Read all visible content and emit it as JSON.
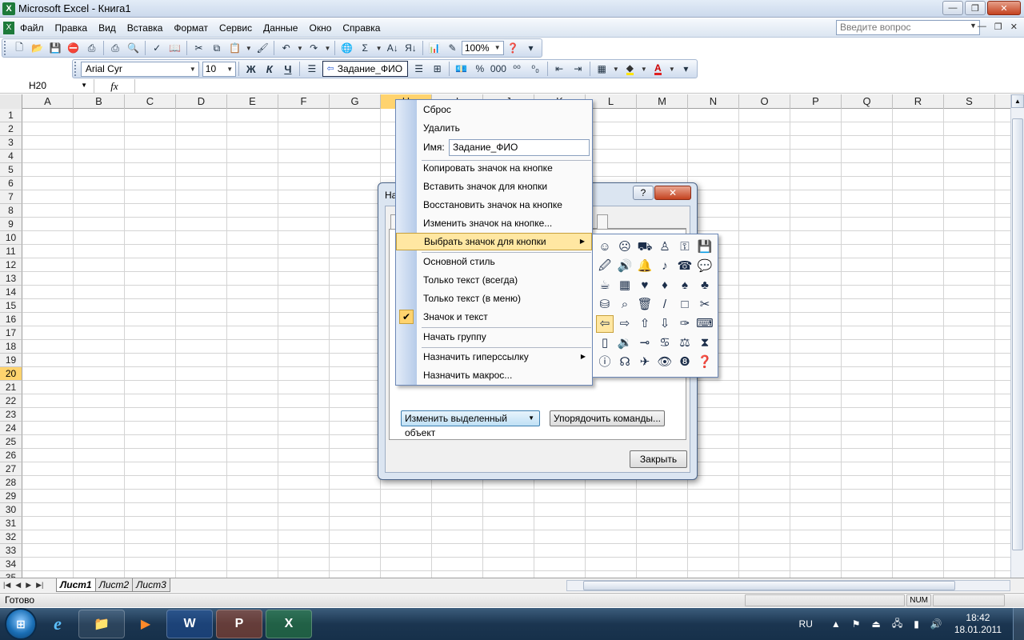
{
  "window": {
    "title": "Microsoft Excel - Книга1",
    "app_icon": "X"
  },
  "menubar": {
    "items": [
      "Файл",
      "Правка",
      "Вид",
      "Вставка",
      "Формат",
      "Сервис",
      "Данные",
      "Окно",
      "Справка"
    ],
    "ask_placeholder": "Введите вопрос"
  },
  "toolbar_standard": {
    "zoom": "100%"
  },
  "toolbar_format": {
    "font": "Arial Cyr",
    "size": "10",
    "custom_button": "Задание_ФИО"
  },
  "formula_bar": {
    "name_box": "H20",
    "fx": "fx"
  },
  "grid": {
    "columns": [
      "A",
      "B",
      "C",
      "D",
      "E",
      "F",
      "G",
      "H",
      "I",
      "J",
      "K",
      "L",
      "M",
      "N",
      "O",
      "P",
      "Q",
      "R",
      "S"
    ],
    "rows": [
      "1",
      "2",
      "3",
      "4",
      "5",
      "6",
      "7",
      "8",
      "9",
      "10",
      "11",
      "12",
      "13",
      "14",
      "15",
      "16",
      "17",
      "18",
      "19",
      "20",
      "21",
      "22",
      "23",
      "24",
      "25",
      "26",
      "27",
      "28",
      "29",
      "30",
      "31",
      "32",
      "33",
      "34",
      "35"
    ],
    "active_row": "20",
    "active_col": "H"
  },
  "sheets": {
    "tabs": [
      "Лист1",
      "Лист2",
      "Лист3"
    ],
    "active": "Лист1"
  },
  "status": {
    "text": "Готово",
    "num": "NUM"
  },
  "dialog": {
    "title_partial": "На",
    "help": "?",
    "close_x": "✕",
    "modify_button": "Изменить выделенный объект",
    "rearrange_button": "Упорядочить команды...",
    "close_button": "Закрыть"
  },
  "context_menu": {
    "reset": "Сброс",
    "delete": "Удалить",
    "name_label": "Имя:",
    "name_value": "Задание_ФИО",
    "copy_icon": "Копировать значок на кнопке",
    "paste_icon": "Вставить значок для кнопки",
    "restore_icon": "Восстановить значок на кнопке",
    "edit_icon": "Изменить значок на кнопке...",
    "choose_icon": "Выбрать значок для кнопки",
    "default_style": "Основной стиль",
    "text_only_always": "Только текст (всегда)",
    "text_only_menu": "Только текст (в меню)",
    "icon_and_text": "Значок и текст",
    "begin_group": "Начать группу",
    "assign_hyperlink": "Назначить гиперссылку",
    "assign_macro": "Назначить макрос..."
  },
  "icon_palette": {
    "icons": [
      "☺",
      "☹",
      "⛟",
      "♙",
      "⚿",
      "💾",
      "🖉",
      "🔊",
      "🔔",
      "♪",
      "☎",
      "💬",
      "☕",
      "▦",
      "♥",
      "♦",
      "♠",
      "♣",
      "⛁",
      "⌕",
      "🗑",
      "/",
      "□",
      "✂",
      "⇦",
      "⇨",
      "⇧",
      "⇩",
      "✑",
      "⌨",
      "▯",
      "🔉",
      "⊸",
      "♋",
      "⚖",
      "⧗",
      "ⓘ",
      "☊",
      "✈",
      "👁",
      "❽",
      "❓"
    ],
    "selected_index": 24
  },
  "taskbar": {
    "lang": "RU",
    "time": "18:42",
    "date": "18.01.2011"
  }
}
